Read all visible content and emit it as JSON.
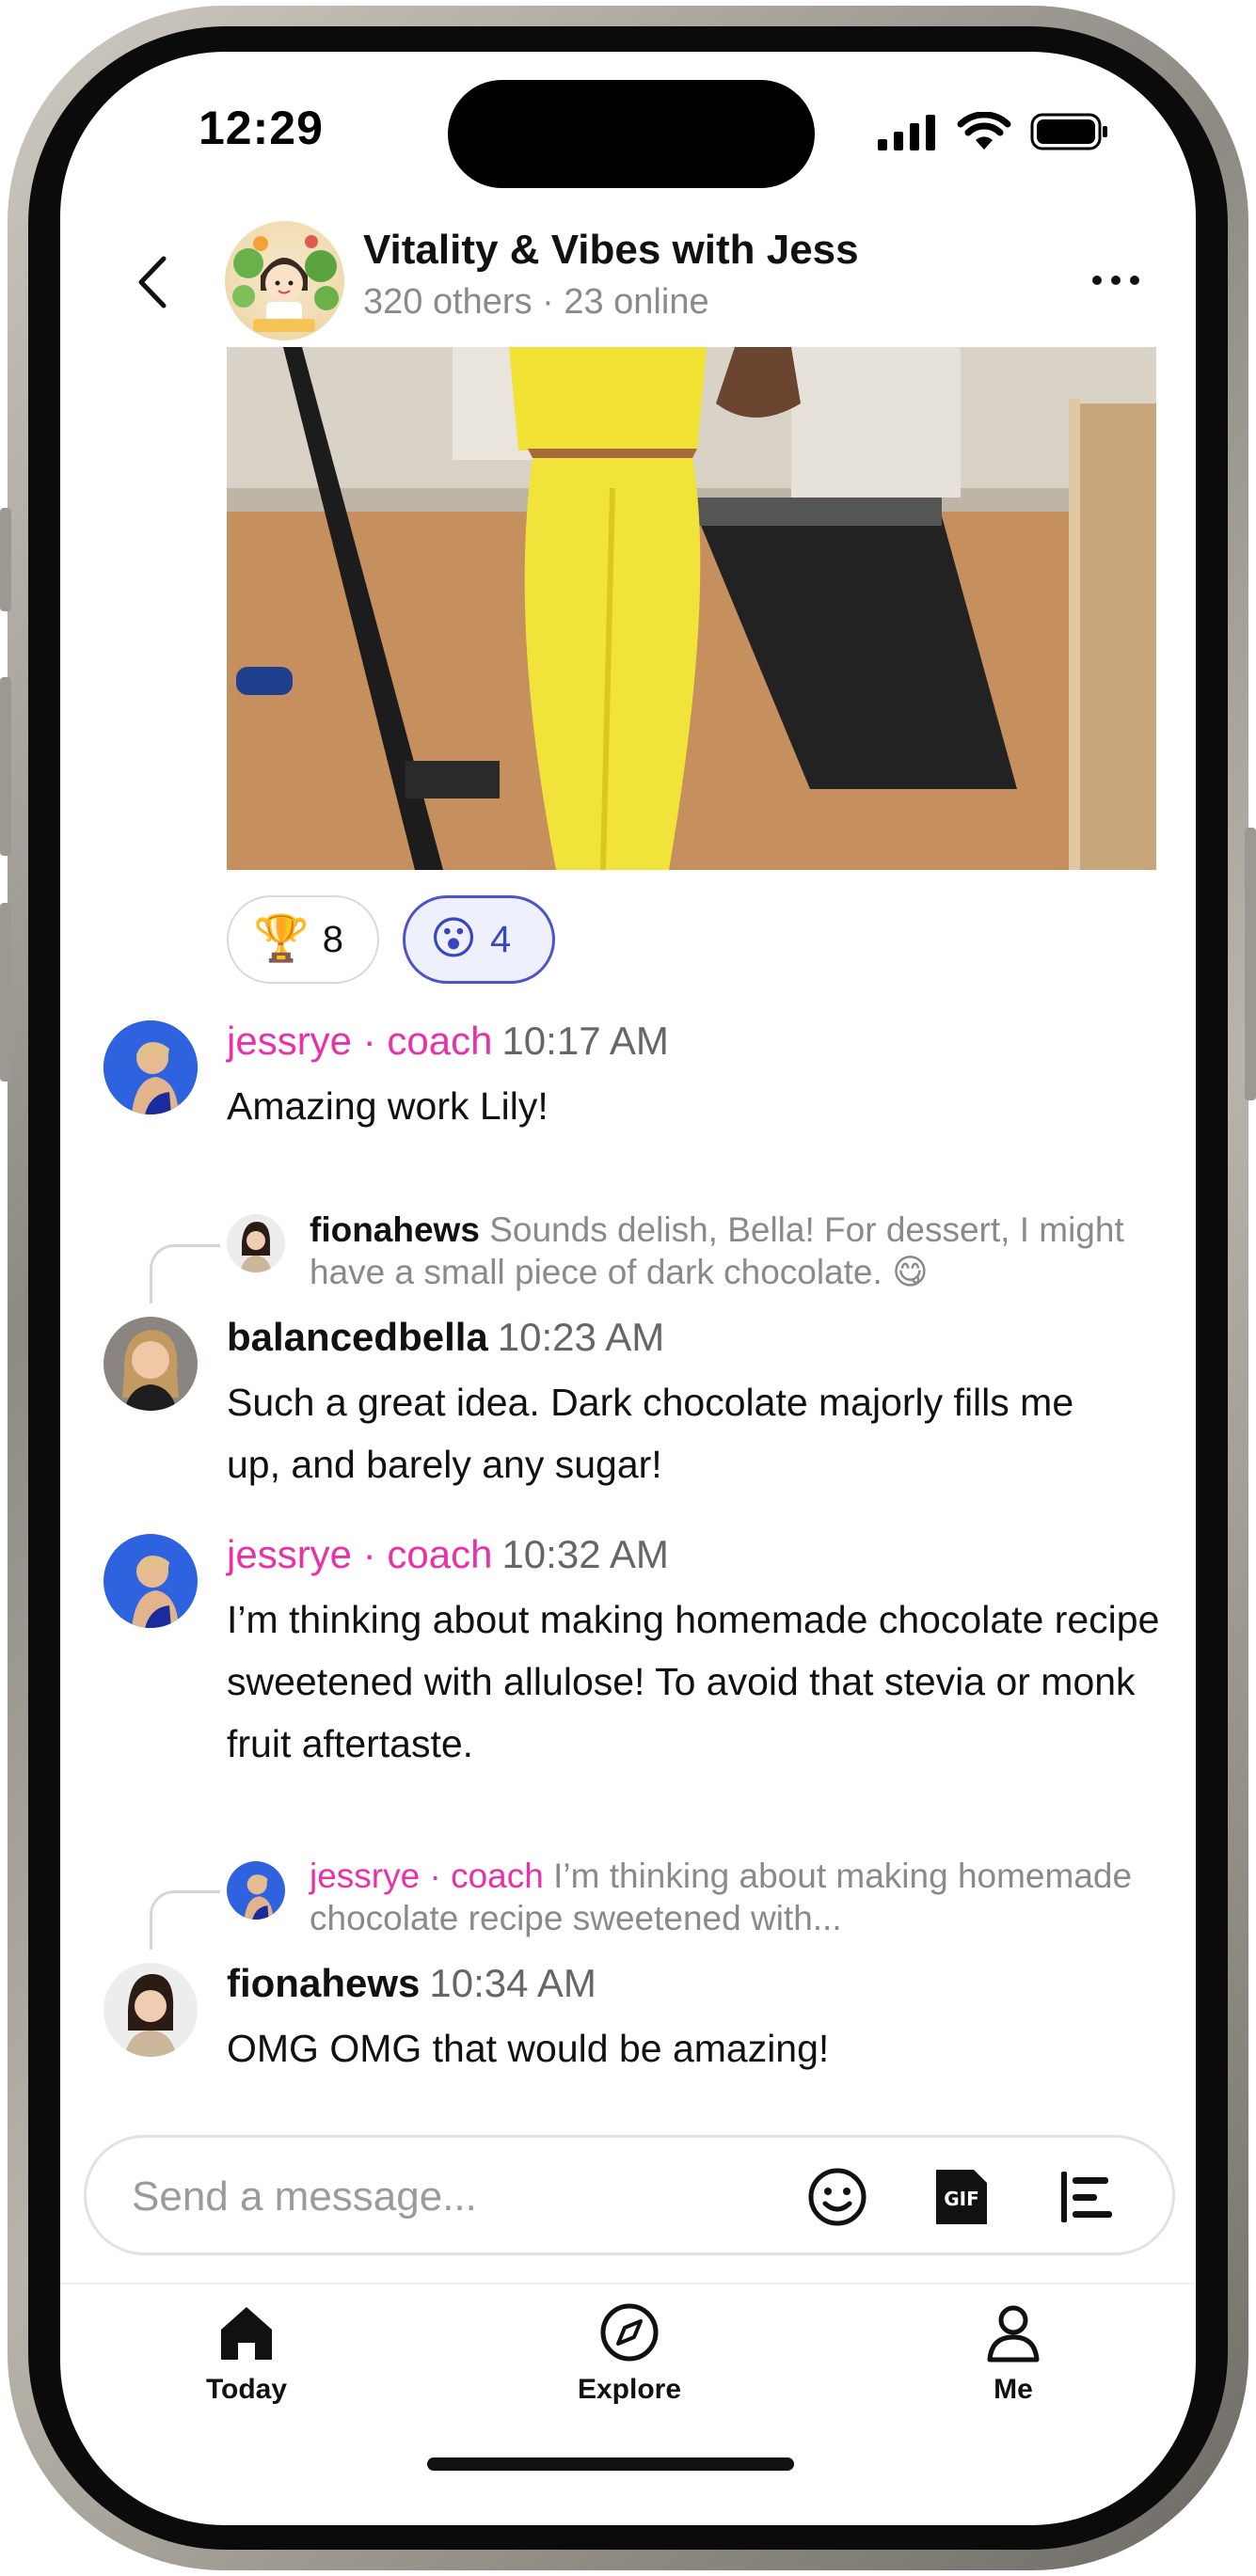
{
  "status_bar": {
    "time": "12:29"
  },
  "header": {
    "title": "Vitality & Vibes with Jess",
    "subtitle": "320 others · 23 online"
  },
  "reactions": [
    {
      "icon": "trophy-icon",
      "emoji": "🏆",
      "count": "8"
    },
    {
      "icon": "surprised-face-icon",
      "emoji": "😮",
      "count": "4"
    }
  ],
  "messages": [
    {
      "user": "jessrye",
      "role": " · coach",
      "time": "10:17 AM",
      "text": "Amazing work Lily!"
    },
    {
      "reply_to": {
        "user": "fionahews",
        "text": " Sounds delish, Bella! For dessert, I might have a small piece of dark chocolate. 😋"
      },
      "user": "balancedbella",
      "time": "10:23 AM",
      "text": "Such a great idea. Dark chocolate majorly fills me up, and barely any sugar!"
    },
    {
      "user": "jessrye",
      "role": " · coach",
      "time": "10:32 AM",
      "text": "I’m thinking about making homemade chocolate recipe sweetened with allulose! To avoid that stevia or monk fruit aftertaste."
    },
    {
      "reply_to": {
        "user": "jessrye",
        "role": " · coach",
        "text": " I’m thinking about making homemade chocolate recipe sweetened with..."
      },
      "user": "fionahews",
      "time": "10:34 AM",
      "text": "OMG OMG that would be amazing!"
    }
  ],
  "composer": {
    "placeholder": "Send a message...",
    "gif_label": "GIF"
  },
  "tabs": [
    {
      "label": "Today",
      "icon": "home-icon"
    },
    {
      "label": "Explore",
      "icon": "compass-icon"
    },
    {
      "label": "Me",
      "icon": "person-icon"
    }
  ],
  "colors": {
    "coach_accent": "#e832a6",
    "reaction_selected": "#4b55c8"
  }
}
